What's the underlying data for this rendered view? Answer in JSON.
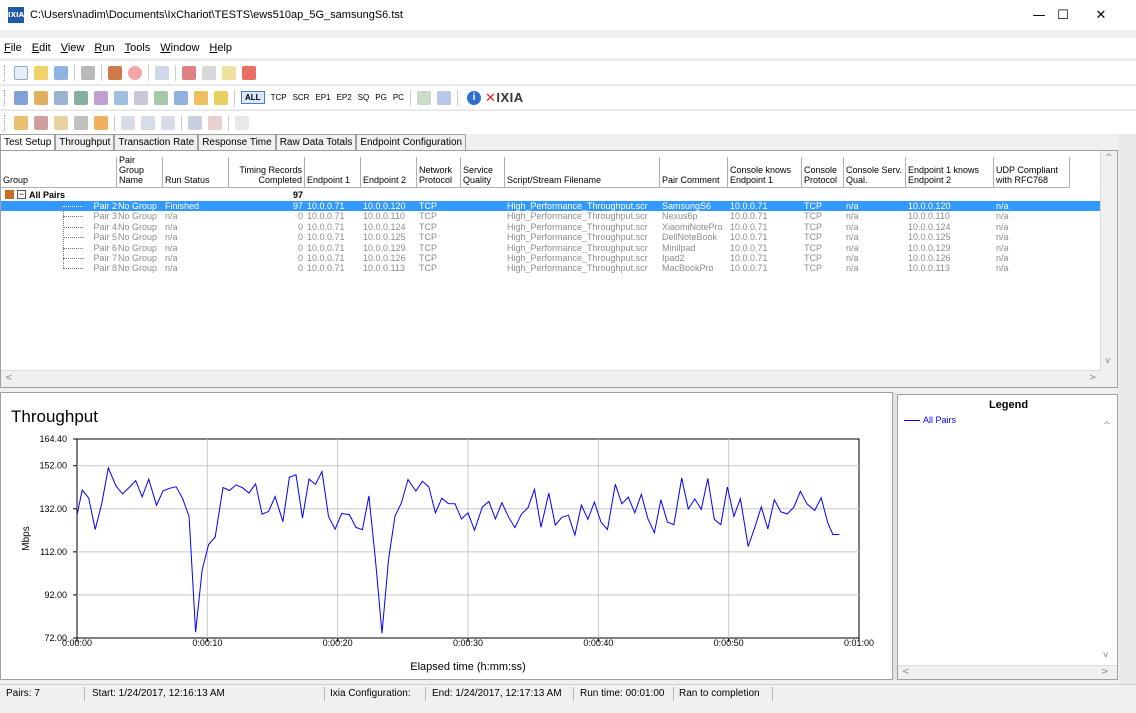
{
  "window": {
    "title": "C:\\Users\\nadim\\Documents\\IxChariot\\TESTS\\ews510ap_5G_samsungS6.tst",
    "app_icon_label": "IXIA",
    "minimize": "—",
    "maximize": "☐",
    "close": "✕"
  },
  "menu": [
    "File",
    "Edit",
    "View",
    "Run",
    "Tools",
    "Window",
    "Help"
  ],
  "toolbar2": {
    "filters": [
      "ALL",
      "TCP",
      "SCR",
      "EP1",
      "EP2",
      "SQ",
      "PG",
      "PC"
    ],
    "logo": "XIXIA"
  },
  "tabs": [
    "Test Setup",
    "Throughput",
    "Transaction Rate",
    "Response Time",
    "Raw Data Totals",
    "Endpoint Configuration"
  ],
  "active_tab": "Test Setup",
  "table": {
    "headers": [
      "Group",
      "Pair Group Name",
      "Run Status",
      "Timing Records Completed",
      "Endpoint 1",
      "Endpoint 2",
      "Network Protocol",
      "Service Quality",
      "Script/Stream Filename",
      "Pair Comment",
      "Console knows Endpoint 1",
      "Console Protocol",
      "Console Serv. Qual.",
      "Endpoint 1 knows Endpoint 2",
      "UDP Compliant with RFC768"
    ],
    "group_row": {
      "label": "All Pairs",
      "records": "97"
    },
    "rows": [
      {
        "pair": "Pair 2",
        "group": "No Group",
        "status": "Finished",
        "records": "97",
        "ep1": "10.0.0.71",
        "ep2": "10.0.0.120",
        "proto": "TCP",
        "qos": "",
        "script": "High_Performance_Throughput.scr",
        "comment": "SamsungS6",
        "cke1": "10.0.0.71",
        "cproto": "TCP",
        "csq": "n/a",
        "e1ke2": "10.0.0.120",
        "udp": "n/a"
      },
      {
        "pair": "Pair 3",
        "group": "No Group",
        "status": "n/a",
        "records": "0",
        "ep1": "10.0.0.71",
        "ep2": "10.0.0.110",
        "proto": "TCP",
        "qos": "",
        "script": "High_Performance_Throughput.scr",
        "comment": "Nexus6p",
        "cke1": "10.0.0.71",
        "cproto": "TCP",
        "csq": "n/a",
        "e1ke2": "10.0.0.110",
        "udp": "n/a"
      },
      {
        "pair": "Pair 4",
        "group": "No Group",
        "status": "n/a",
        "records": "0",
        "ep1": "10.0.0.71",
        "ep2": "10.0.0.124",
        "proto": "TCP",
        "qos": "",
        "script": "High_Performance_Throughput.scr",
        "comment": "XiaomiNotePro",
        "cke1": "10.0.0.71",
        "cproto": "TCP",
        "csq": "n/a",
        "e1ke2": "10.0.0.124",
        "udp": "n/a"
      },
      {
        "pair": "Pair 5",
        "group": "No Group",
        "status": "n/a",
        "records": "0",
        "ep1": "10.0.0.71",
        "ep2": "10.0.0.125",
        "proto": "TCP",
        "qos": "",
        "script": "High_Performance_Throughput.scr",
        "comment": "DellNoteBook",
        "cke1": "10.0.0.71",
        "cproto": "TCP",
        "csq": "n/a",
        "e1ke2": "10.0.0.125",
        "udp": "n/a"
      },
      {
        "pair": "Pair 6",
        "group": "No Group",
        "status": "n/a",
        "records": "0",
        "ep1": "10.0.0.71",
        "ep2": "10.0.0.129",
        "proto": "TCP",
        "qos": "",
        "script": "High_Performance_Throughput.scr",
        "comment": "Minilpad",
        "cke1": "10.0.0.71",
        "cproto": "TCP",
        "csq": "n/a",
        "e1ke2": "10.0.0.129",
        "udp": "n/a"
      },
      {
        "pair": "Pair 7",
        "group": "No Group",
        "status": "n/a",
        "records": "0",
        "ep1": "10.0.0.71",
        "ep2": "10.0.0.126",
        "proto": "TCP",
        "qos": "",
        "script": "High_Performance_Throughput.scr",
        "comment": "Ipad2",
        "cke1": "10.0.0.71",
        "cproto": "TCP",
        "csq": "n/a",
        "e1ke2": "10.0.0.126",
        "udp": "n/a"
      },
      {
        "pair": "Pair 8",
        "group": "No Group",
        "status": "n/a",
        "records": "0",
        "ep1": "10.0.0.71",
        "ep2": "10.0.0.113",
        "proto": "TCP",
        "qos": "",
        "script": "High_Performance_Throughput.scr",
        "comment": "MacBookPro",
        "cke1": "10.0.0.71",
        "cproto": "TCP",
        "csq": "n/a",
        "e1ke2": "10.0.0.113",
        "udp": "n/a"
      }
    ]
  },
  "chart_data": {
    "type": "line",
    "title": "Throughput",
    "xlabel": "Elapsed time (h:mm:ss)",
    "ylabel": "Mbps",
    "ylim": [
      72.0,
      164.4
    ],
    "xlim": [
      0,
      60
    ],
    "yticks": [
      "164.40",
      "152.00",
      "132.00",
      "112.00",
      "92.00",
      "72.00"
    ],
    "xticks": [
      "0:00:00",
      "0:00:10",
      "0:00:20",
      "0:00:30",
      "0:00:40",
      "0:00:50",
      "0:01:00"
    ],
    "grid": true,
    "series": [
      {
        "name": "All Pairs",
        "color": "#0000ff",
        "x": [
          0.0,
          0.4,
          0.9,
          1.4,
          1.9,
          2.4,
          3.0,
          3.5,
          4.0,
          4.5,
          5.0,
          5.5,
          6.1,
          6.6,
          7.1,
          7.6,
          8.1,
          8.6,
          9.1,
          9.6,
          10.1,
          10.6,
          11.2,
          11.7,
          12.2,
          12.7,
          13.2,
          13.7,
          14.2,
          14.7,
          15.2,
          15.8,
          16.3,
          16.8,
          17.3,
          17.8,
          18.3,
          18.8,
          19.3,
          19.8,
          20.3,
          20.9,
          21.4,
          21.9,
          22.4,
          22.9,
          23.4,
          23.9,
          24.4,
          24.9,
          25.4,
          26.0,
          26.5,
          27.0,
          27.5,
          28.0,
          28.5,
          29.0,
          29.5,
          30.0,
          30.5,
          31.1,
          31.6,
          32.1,
          32.6,
          33.1,
          33.6,
          34.1,
          34.6,
          35.1,
          35.6,
          36.2,
          36.7,
          37.2,
          37.7,
          38.2,
          38.7,
          39.2,
          39.7,
          40.2,
          40.7,
          41.3,
          41.8,
          42.3,
          42.8,
          43.3,
          43.8,
          44.3,
          44.8,
          45.3,
          45.8,
          46.4,
          46.9,
          47.4,
          47.9,
          48.4,
          48.9,
          49.4,
          49.9,
          50.4,
          50.9,
          51.5,
          52.0,
          52.5,
          53.0,
          53.5,
          54.0,
          54.5,
          55.0,
          55.5,
          56.0,
          56.6,
          57.1,
          57.6,
          58.0,
          58.5
        ],
        "values": [
          129.0,
          140.7,
          137.0,
          122.4,
          134.5,
          151.0,
          142.5,
          138.9,
          141.9,
          145.1,
          137.5,
          145.8,
          133.6,
          140.3,
          141.5,
          142.2,
          136.8,
          128.4,
          74.7,
          103.5,
          115.4,
          118.9,
          141.9,
          140.5,
          143.1,
          141.8,
          139.3,
          143.6,
          129.5,
          130.8,
          137.7,
          126.0,
          146.6,
          147.8,
          127.7,
          145.8,
          143.3,
          149.3,
          128.5,
          122.5,
          129.8,
          129.3,
          123.4,
          122.3,
          138.0,
          108.1,
          74.2,
          108.3,
          128.6,
          134.8,
          145.6,
          140.2,
          144.8,
          142.1,
          130.1,
          136.9,
          134.4,
          134.3,
          127.3,
          130.1,
          122.0,
          132.8,
          135.4,
          127.3,
          134.8,
          128.3,
          123.2,
          129.5,
          132.5,
          141.0,
          123.4,
          139.3,
          124.4,
          128.0,
          129.0,
          119.8,
          133.7,
          127.1,
          135.1,
          125.9,
          122.4,
          143.4,
          134.3,
          137.4,
          130.1,
          138.7,
          127.4,
          120.9,
          136.2,
          125.8,
          124.6,
          146.3,
          131.9,
          136.6,
          131.7,
          146.1,
          127.1,
          124.6,
          142.1,
          128.5,
          136.7,
          114.5,
          123.2,
          132.9,
          122.6,
          136.2,
          130.6,
          129.6,
          132.7,
          140.1,
          134.3,
          131.2,
          137.1,
          125.6,
          120.0,
          120.1
        ]
      }
    ]
  },
  "legend": {
    "title": "Legend",
    "items": [
      "All Pairs"
    ]
  },
  "status": {
    "pairs": "Pairs: 7",
    "start": "Start: 1/24/2017, 12:16:13 AM",
    "config": "Ixia Configuration:",
    "end": "End: 1/24/2017, 12:17:13 AM",
    "runtime": "Run time: 00:01:00",
    "result": "Ran to completion"
  }
}
